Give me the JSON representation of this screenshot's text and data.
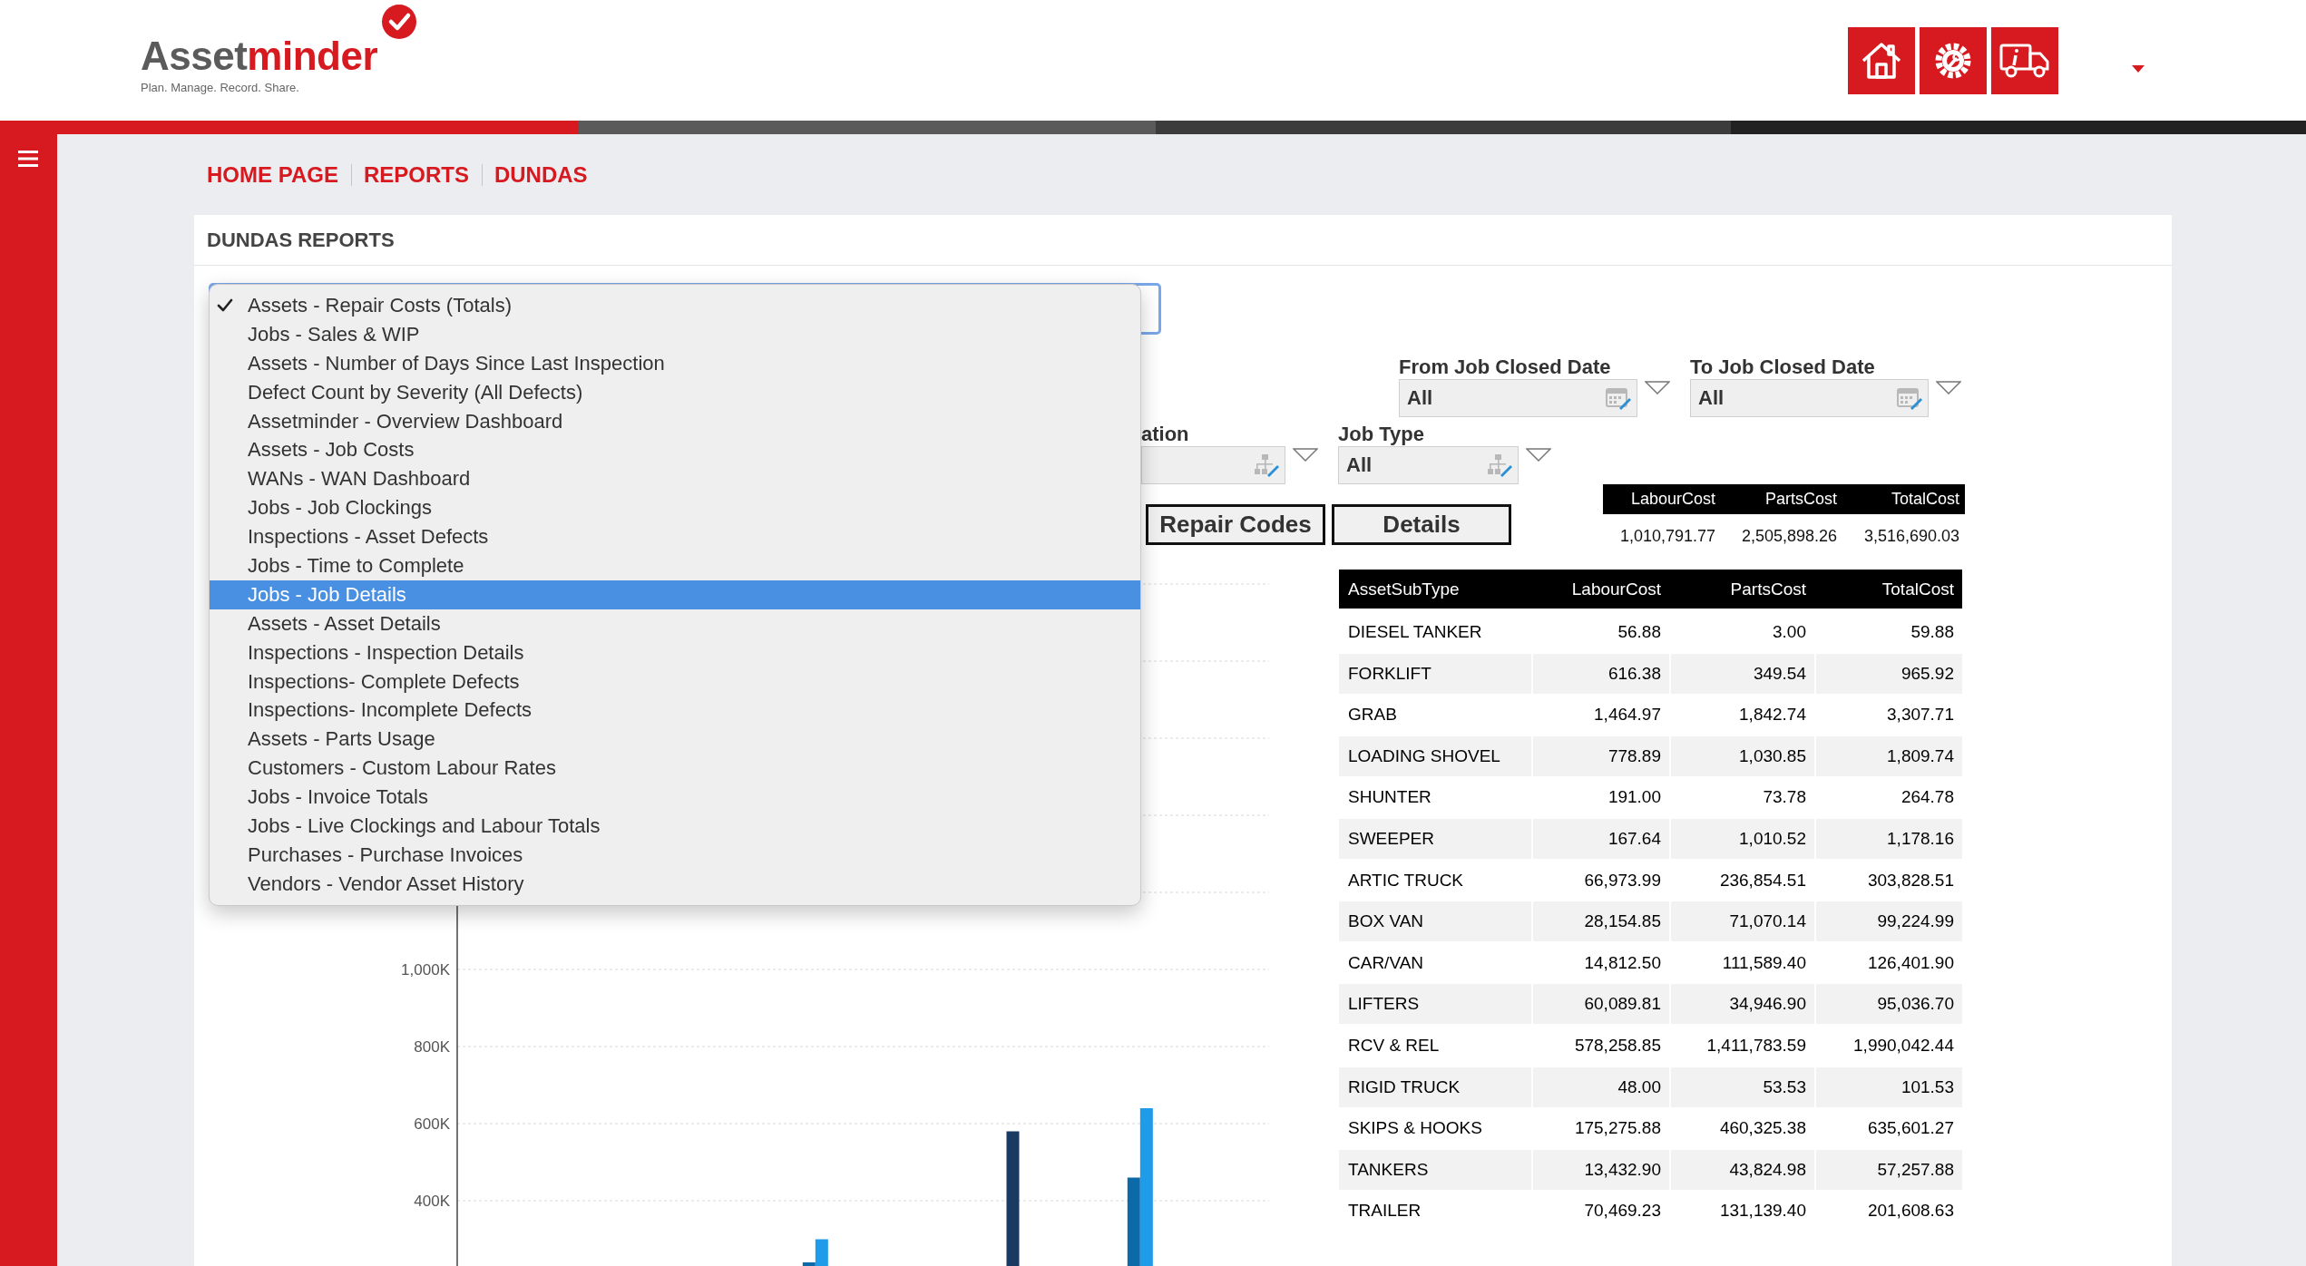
{
  "header": {
    "logo": {
      "wordmark": [
        "Asset",
        "minder"
      ],
      "tagline": "Plan. Manage. Record. Share."
    },
    "icon_buttons": [
      {
        "kind": "home"
      },
      {
        "kind": "gear"
      },
      {
        "kind": "truck"
      }
    ]
  },
  "breadcrumb": [
    "HOME PAGE",
    "REPORTS",
    "DUNDAS"
  ],
  "report_card": {
    "title": "DUNDAS REPORTS",
    "report_select": {
      "expanded": true,
      "options": [
        {
          "label": "Assets - Repair Costs (Totals)",
          "checked": true,
          "selected": false
        },
        {
          "label": "Jobs - Sales & WIP",
          "checked": false,
          "selected": false
        },
        {
          "label": "Assets - Number of Days Since Last Inspection",
          "checked": false,
          "selected": false
        },
        {
          "label": "Defect Count by Severity (All Defects)",
          "checked": false,
          "selected": false
        },
        {
          "label": "Assetminder - Overview Dashboard",
          "checked": false,
          "selected": false
        },
        {
          "label": "Assets - Job Costs",
          "checked": false,
          "selected": false
        },
        {
          "label": "WANs - WAN Dashboard",
          "checked": false,
          "selected": false
        },
        {
          "label": "Jobs - Job Clockings",
          "checked": false,
          "selected": false
        },
        {
          "label": "Inspections - Asset Defects",
          "checked": false,
          "selected": false
        },
        {
          "label": "Jobs - Time to Complete",
          "checked": false,
          "selected": false
        },
        {
          "label": "Jobs - Job Details",
          "checked": false,
          "selected": true
        },
        {
          "label": "Assets - Asset Details",
          "checked": false,
          "selected": false
        },
        {
          "label": "Inspections - Inspection Details",
          "checked": false,
          "selected": false
        },
        {
          "label": "Inspections- Complete Defects",
          "checked": false,
          "selected": false
        },
        {
          "label": "Inspections- Incomplete Defects",
          "checked": false,
          "selected": false
        },
        {
          "label": "Assets - Parts Usage",
          "checked": false,
          "selected": false
        },
        {
          "label": "Customers - Custom Labour Rates",
          "checked": false,
          "selected": false
        },
        {
          "label": "Jobs - Invoice Totals",
          "checked": false,
          "selected": false
        },
        {
          "label": "Jobs - Live Clockings and Labour Totals",
          "checked": false,
          "selected": false
        },
        {
          "label": "Purchases - Purchase Invoices",
          "checked": false,
          "selected": false
        },
        {
          "label": "Vendors - Vendor Asset History",
          "checked": false,
          "selected": false
        }
      ]
    },
    "filters": [
      [
        {
          "label": "From Job Closed Date",
          "value": "All",
          "kind": "date"
        },
        {
          "label": "To Job Closed Date",
          "value": "All",
          "kind": "date"
        }
      ],
      [
        {
          "label": "ation",
          "kind": "tree"
        },
        {
          "label": "Job Type",
          "value": "All",
          "kind": "tree"
        }
      ]
    ],
    "buttons": [
      "Repair Codes",
      "Details"
    ],
    "totals_table": {
      "columns": [
        "LabourCost",
        "PartsCost",
        "TotalCost"
      ],
      "rows": [
        [
          "1,010,791.77",
          "2,505,898.26",
          "3,516,690.03"
        ]
      ]
    },
    "detail_table": {
      "columns": [
        "AssetSubType",
        "LabourCost",
        "PartsCost",
        "TotalCost"
      ],
      "rows": [
        [
          "DIESEL TANKER",
          "56.88",
          "3.00",
          "59.88"
        ],
        [
          "FORKLIFT",
          "616.38",
          "349.54",
          "965.92"
        ],
        [
          "GRAB",
          "1,464.97",
          "1,842.74",
          "3,307.71"
        ],
        [
          "LOADING SHOVEL",
          "778.89",
          "1,030.85",
          "1,809.74"
        ],
        [
          "SHUNTER",
          "191.00",
          "73.78",
          "264.78"
        ],
        [
          "SWEEPER",
          "167.64",
          "1,010.52",
          "1,178.16"
        ],
        [
          "ARTIC TRUCK",
          "66,973.99",
          "236,854.51",
          "303,828.51"
        ],
        [
          "BOX VAN",
          "28,154.85",
          "71,070.14",
          "99,224.99"
        ],
        [
          "CAR/VAN",
          "14,812.50",
          "111,589.40",
          "126,401.90"
        ],
        [
          "LIFTERS",
          "60,089.81",
          "34,946.90",
          "95,036.70"
        ],
        [
          "RCV & REL",
          "578,258.85",
          "1,411,783.59",
          "1,990,042.44"
        ],
        [
          "RIGID TRUCK",
          "48.00",
          "53.53",
          "101.53"
        ],
        [
          "SKIPS & HOOKS",
          "175,275.88",
          "460,325.38",
          "635,601.27"
        ],
        [
          "TANKERS",
          "13,432.90",
          "43,824.98",
          "57,257.88"
        ],
        [
          "TRAILER",
          "70,469.23",
          "131,139.40",
          "201,608.63"
        ]
      ]
    },
    "chart": {
      "chart_data": {
        "type": "bar",
        "grid": true,
        "ylim": [
          0,
          2000000
        ],
        "yticks": [
          {
            "value": 400000,
            "label": "400K"
          },
          {
            "value": 600000,
            "label": "600K"
          },
          {
            "value": 800000,
            "label": "800K"
          },
          {
            "value": 1000000,
            "label": "1,000K"
          }
        ],
        "series": [
          {
            "color": "#1b3a62",
            "values": [
              null,
              null,
              null,
              null,
              null,
              null,
              null,
              null,
              null,
              null,
              580000,
              null,
              null,
              null,
              null
            ]
          },
          {
            "color": "#0d6aa8",
            "values": [
              null,
              null,
              null,
              null,
              null,
              null,
              240000,
              null,
              null,
              null,
              null,
              null,
              460000,
              null,
              null
            ]
          },
          {
            "color": "#1e9be9",
            "values": [
              null,
              null,
              null,
              null,
              null,
              null,
              300000,
              null,
              null,
              null,
              null,
              null,
              640000,
              null,
              null
            ]
          }
        ]
      }
    }
  }
}
